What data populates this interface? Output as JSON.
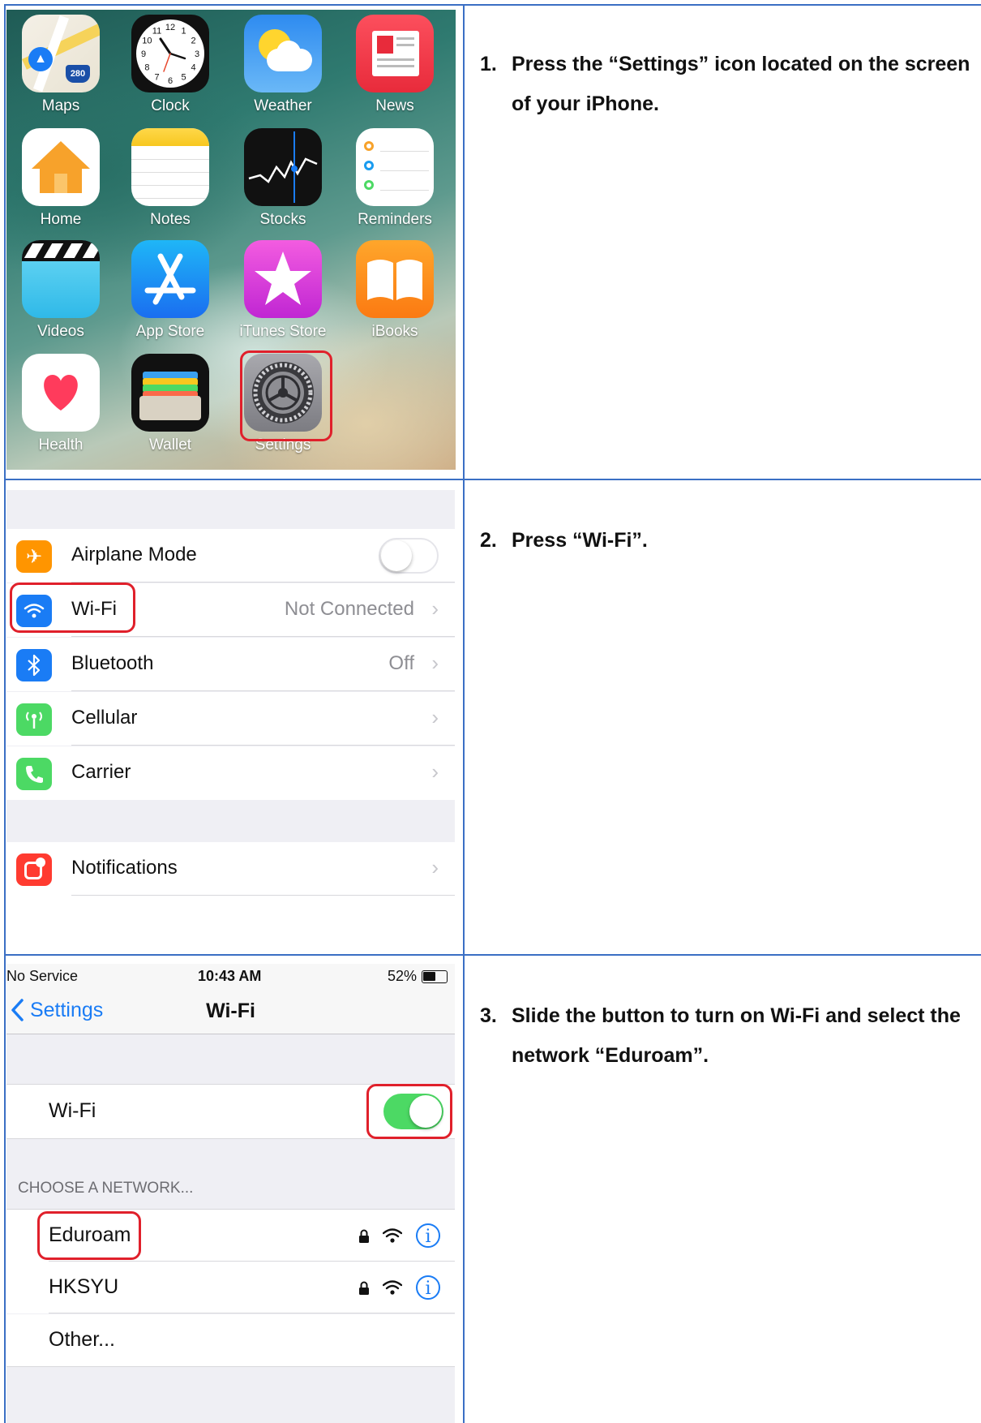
{
  "steps": [
    {
      "num": "1.",
      "text": "Press the “Settings” icon located on the screen of your iPhone."
    },
    {
      "num": "2.",
      "text": "Press “Wi-Fi”."
    },
    {
      "num": "3.",
      "text": "Slide the button to turn on Wi-Fi and select the network “Eduroam”."
    }
  ],
  "home": {
    "apps": [
      {
        "label": "Maps"
      },
      {
        "label": "Clock"
      },
      {
        "label": "Weather"
      },
      {
        "label": "News"
      },
      {
        "label": "Home"
      },
      {
        "label": "Notes"
      },
      {
        "label": "Stocks"
      },
      {
        "label": "Reminders"
      },
      {
        "label": "Videos"
      },
      {
        "label": "App Store"
      },
      {
        "label": "iTunes Store"
      },
      {
        "label": "iBooks"
      },
      {
        "label": "Health"
      },
      {
        "label": "Wallet"
      },
      {
        "label": "Settings"
      }
    ],
    "clock_numbers": [
      "12",
      "1",
      "2",
      "3",
      "4",
      "5",
      "6",
      "7",
      "8",
      "9",
      "10",
      "11"
    ],
    "maps_badge": "280"
  },
  "settings": {
    "rows": [
      {
        "label": "Airplane Mode",
        "value": ""
      },
      {
        "label": "Wi-Fi",
        "value": "Not Connected"
      },
      {
        "label": "Bluetooth",
        "value": "Off"
      },
      {
        "label": "Cellular",
        "value": ""
      },
      {
        "label": "Carrier",
        "value": ""
      },
      {
        "label": "Notifications",
        "value": ""
      }
    ],
    "chevron": "›"
  },
  "wifi": {
    "status_left": "No Service",
    "time": "10:43 AM",
    "battery": "52%",
    "back_label": "Settings",
    "title": "Wi-Fi",
    "toggle_label": "Wi-Fi",
    "section_header": "CHOOSE A NETWORK...",
    "networks": [
      {
        "name": "Eduroam"
      },
      {
        "name": "HKSYU"
      },
      {
        "name": "Other..."
      }
    ],
    "info_glyph": "i"
  }
}
